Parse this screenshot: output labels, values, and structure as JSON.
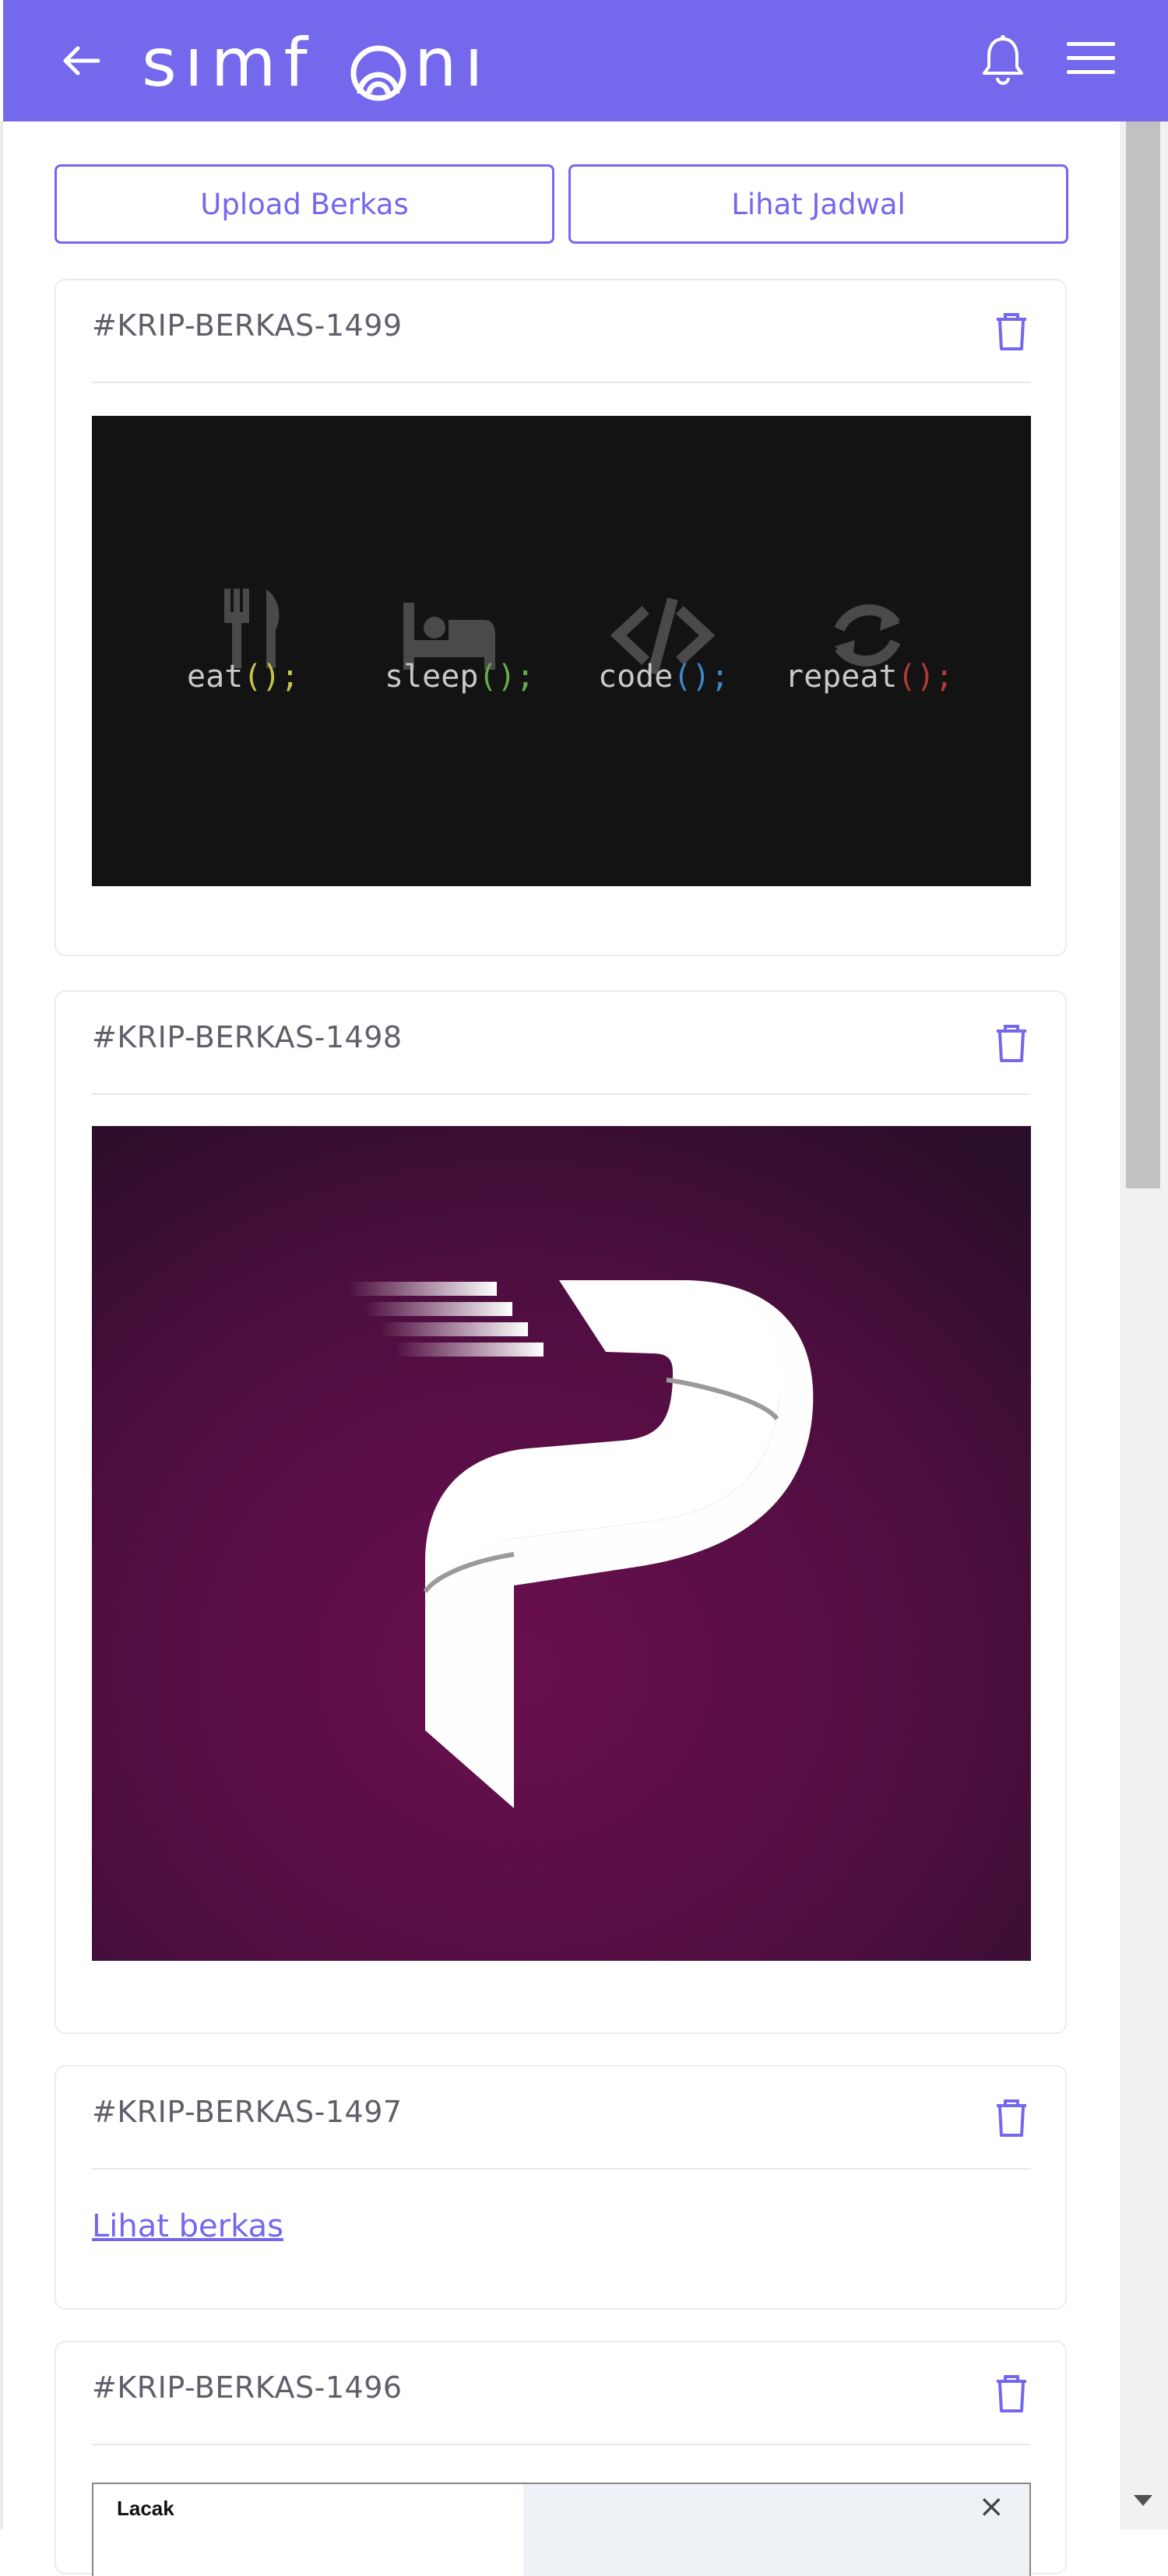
{
  "header": {
    "brand": "simfoni",
    "icons": [
      "back-arrow-icon",
      "bell-icon",
      "hamburger-menu-icon"
    ],
    "colors": {
      "primary": "#7468ec",
      "white": "#ffffff"
    }
  },
  "actions": {
    "upload_label": "Upload Berkas",
    "schedule_label": "Lihat Jadwal"
  },
  "cards": [
    {
      "id": "#KRIP-BERKAS-1499",
      "content": "image",
      "image": {
        "words": [
          "eat",
          "sleep",
          "code",
          "repeat"
        ],
        "punct": [
          "();",
          "();",
          "();",
          "();"
        ],
        "colors": [
          "#c9c34a",
          "#6aa84f",
          "#3d85c6",
          "#b03a3a"
        ],
        "icons": [
          "fork-knife-icon",
          "bed-icon",
          "code-brackets-icon",
          "refresh-icon"
        ]
      }
    },
    {
      "id": "#KRIP-BERKAS-1498",
      "content": "image",
      "image": {
        "subject": "p-logo"
      }
    },
    {
      "id": "#KRIP-BERKAS-1497",
      "content": "link",
      "link_label": "Lihat berkas"
    },
    {
      "id": "#KRIP-BERKAS-1496",
      "content": "image",
      "image": {
        "caption": "Lacak",
        "close_glyph": "×"
      }
    }
  ]
}
